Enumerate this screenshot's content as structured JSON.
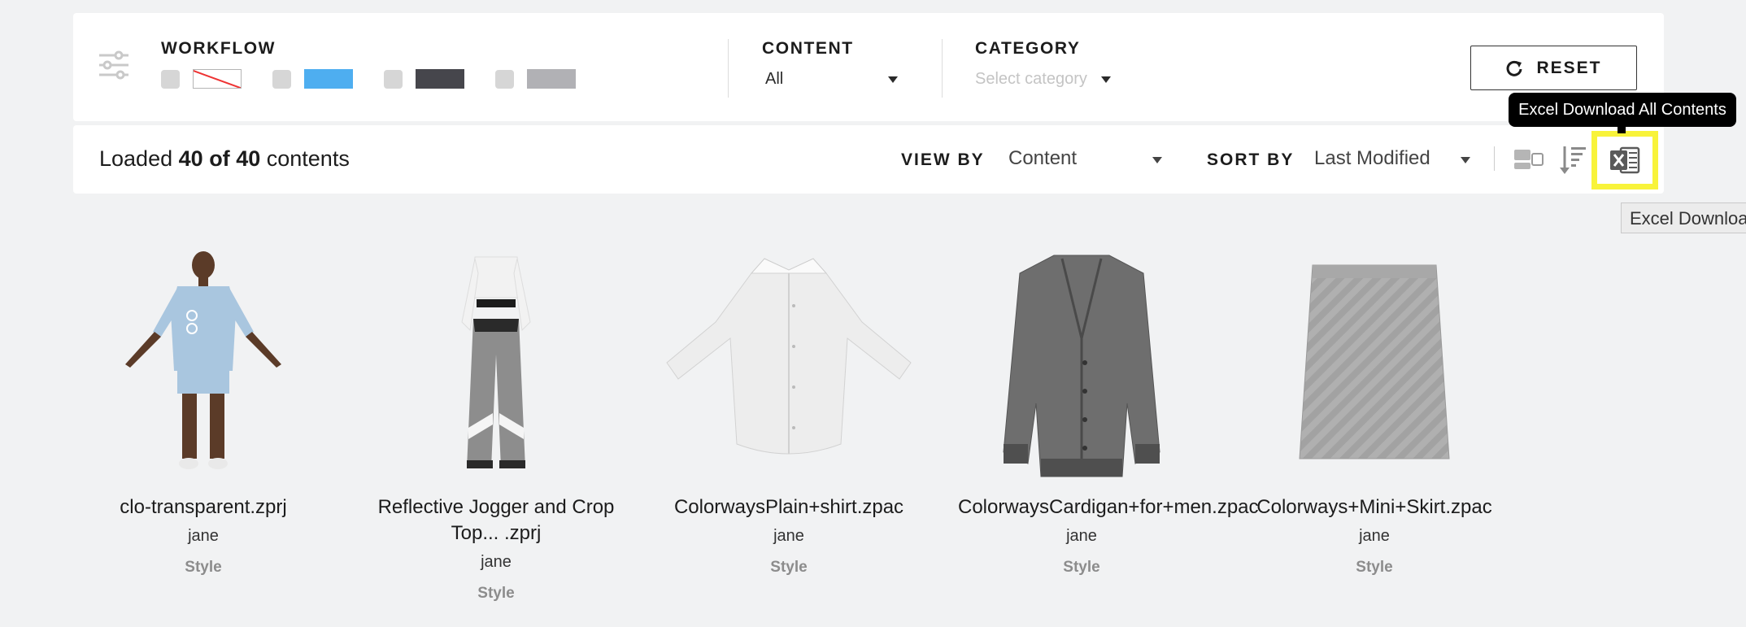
{
  "filters": {
    "workflow_label": "WORKFLOW",
    "workflow_swatches": [
      {
        "color": "none"
      },
      {
        "color": "#4eaef0"
      },
      {
        "color": "#46464c"
      },
      {
        "color": "#b1b1b5"
      }
    ],
    "content_label": "CONTENT",
    "content_value": "All",
    "category_label": "CATEGORY",
    "category_placeholder": "Select category",
    "reset_label": "RESET"
  },
  "toolbar": {
    "loaded_prefix": "Loaded",
    "loaded_count": "40",
    "loaded_of": "of",
    "loaded_total": "40",
    "loaded_suffix": "contents",
    "view_by_label": "VIEW BY",
    "view_by_value": "Content",
    "sort_by_label": "SORT BY",
    "sort_by_value": "Last Modified"
  },
  "tooltips": {
    "dark": "Excel Download All Contents",
    "light": "Excel Download"
  },
  "cards": [
    {
      "name": "clo-transparent.zprj",
      "owner": "jane",
      "type": "Style"
    },
    {
      "name": "Reflective Jogger and Crop Top... .zprj",
      "owner": "jane",
      "type": "Style"
    },
    {
      "name": "ColorwaysPlain+shirt.zpac",
      "owner": "jane",
      "type": "Style"
    },
    {
      "name": "ColorwaysCardigan+for+men.zpac",
      "owner": "jane",
      "type": "Style"
    },
    {
      "name": "Colorways+Mini+Skirt.zpac",
      "owner": "jane",
      "type": "Style"
    }
  ],
  "icons": {
    "filter": "sliders-icon",
    "reset": "refresh-icon",
    "view_toggle": "view-toggle-icon",
    "sort": "sort-descending-icon",
    "excel": "excel-download-icon"
  },
  "colors": {
    "highlight": "#f8f33a",
    "accent_blue": "#4eaef0"
  }
}
